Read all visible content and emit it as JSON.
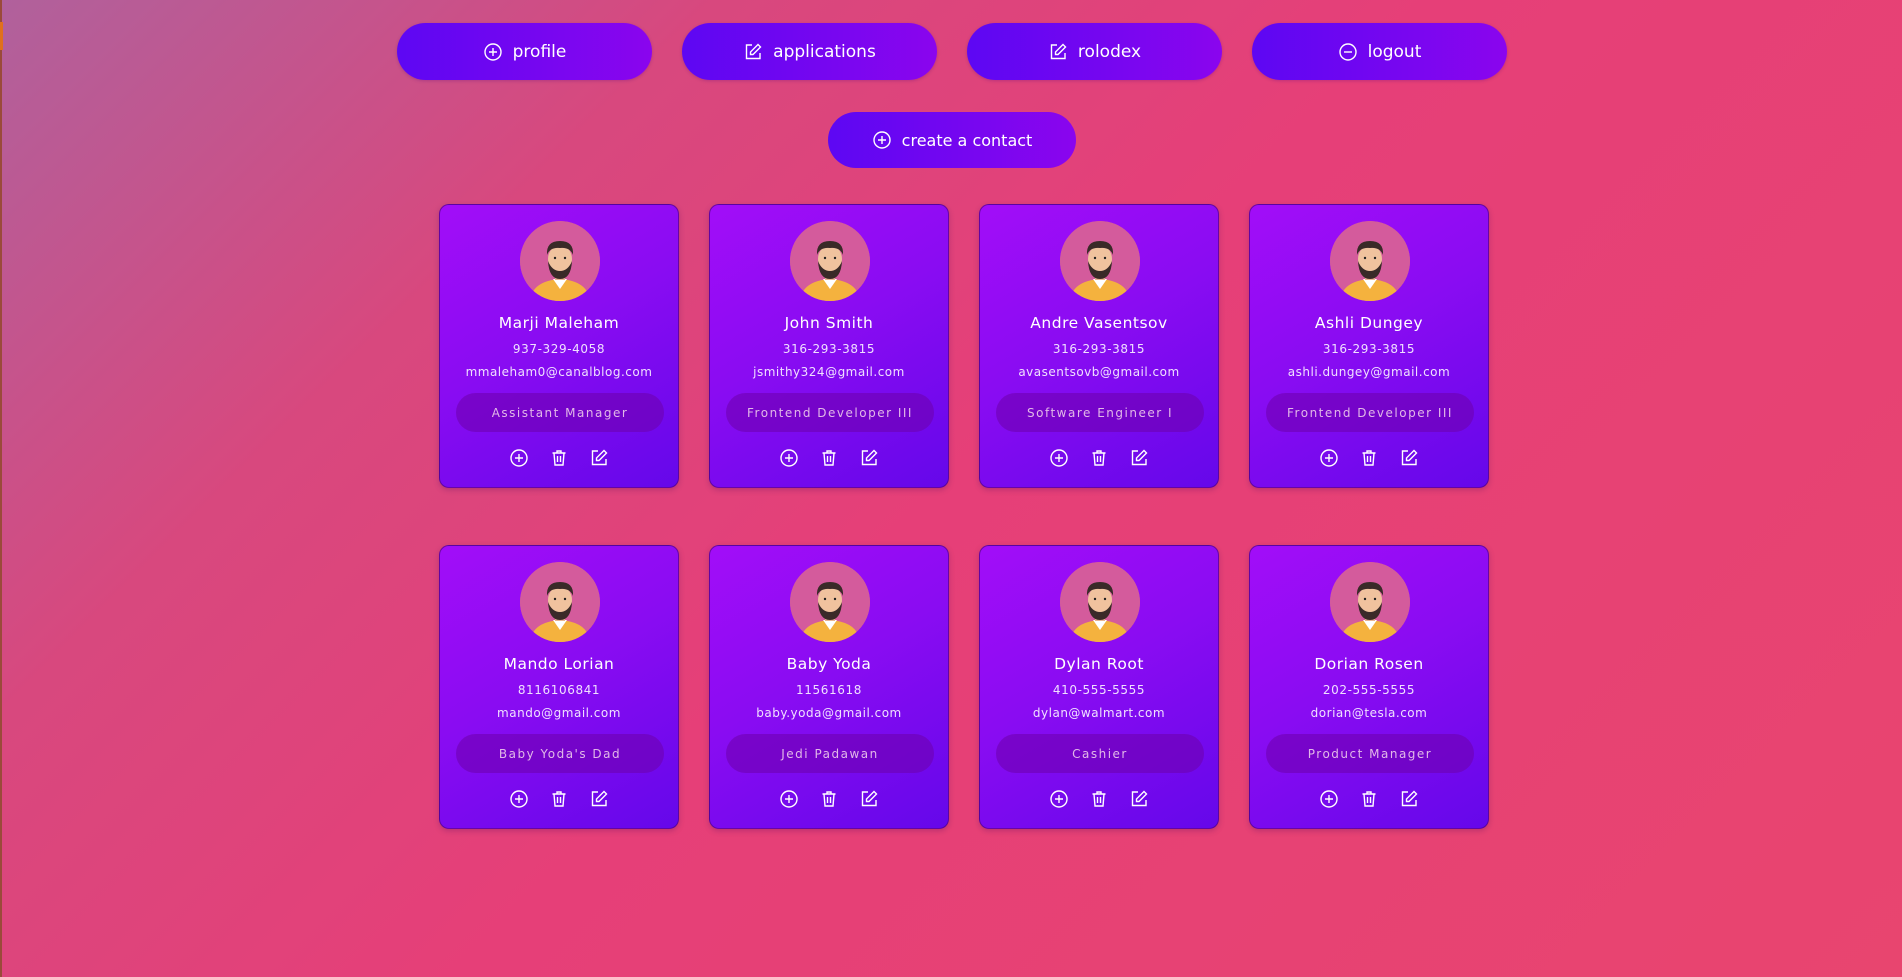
{
  "nav": [
    {
      "label": "profile",
      "icon": "plus-circle-icon"
    },
    {
      "label": "applications",
      "icon": "edit-icon"
    },
    {
      "label": "rolodex",
      "icon": "edit-icon"
    },
    {
      "label": "logout",
      "icon": "minus-circle-icon"
    }
  ],
  "create_button": {
    "label": "create a contact",
    "icon": "plus-circle-icon"
  },
  "contacts": [
    {
      "name": "Marji Maleham",
      "phone": "937-329-4058",
      "email": "mmaleham0@canalblog.com",
      "role": "Assistant Manager"
    },
    {
      "name": "John Smith",
      "phone": "316-293-3815",
      "email": "jsmithy324@gmail.com",
      "role": "Frontend Developer III"
    },
    {
      "name": "Andre Vasentsov",
      "phone": "316-293-3815",
      "email": "avasentsovb@gmail.com",
      "role": "Software Engineer I"
    },
    {
      "name": "Ashli Dungey",
      "phone": "316-293-3815",
      "email": "ashli.dungey@gmail.com",
      "role": "Frontend Developer III"
    },
    {
      "name": "Mando Lorian",
      "phone": "8116106841",
      "email": "mando@gmail.com",
      "role": "Baby Yoda's Dad"
    },
    {
      "name": "Baby Yoda",
      "phone": "11561618",
      "email": "baby.yoda@gmail.com",
      "role": "Jedi Padawan"
    },
    {
      "name": "Dylan Root",
      "phone": "410-555-5555",
      "email": "dylan@walmart.com",
      "role": "Cashier"
    },
    {
      "name": "Dorian Rosen",
      "phone": "202-555-5555",
      "email": "dorian@tesla.com",
      "role": "Product Manager"
    }
  ],
  "card_actions": [
    "plus-circle-icon",
    "trash-icon",
    "edit-icon"
  ],
  "colors": {
    "button": "#7006f0",
    "card": "#8a0cf2",
    "avatar_bg": "#d45b9c"
  }
}
